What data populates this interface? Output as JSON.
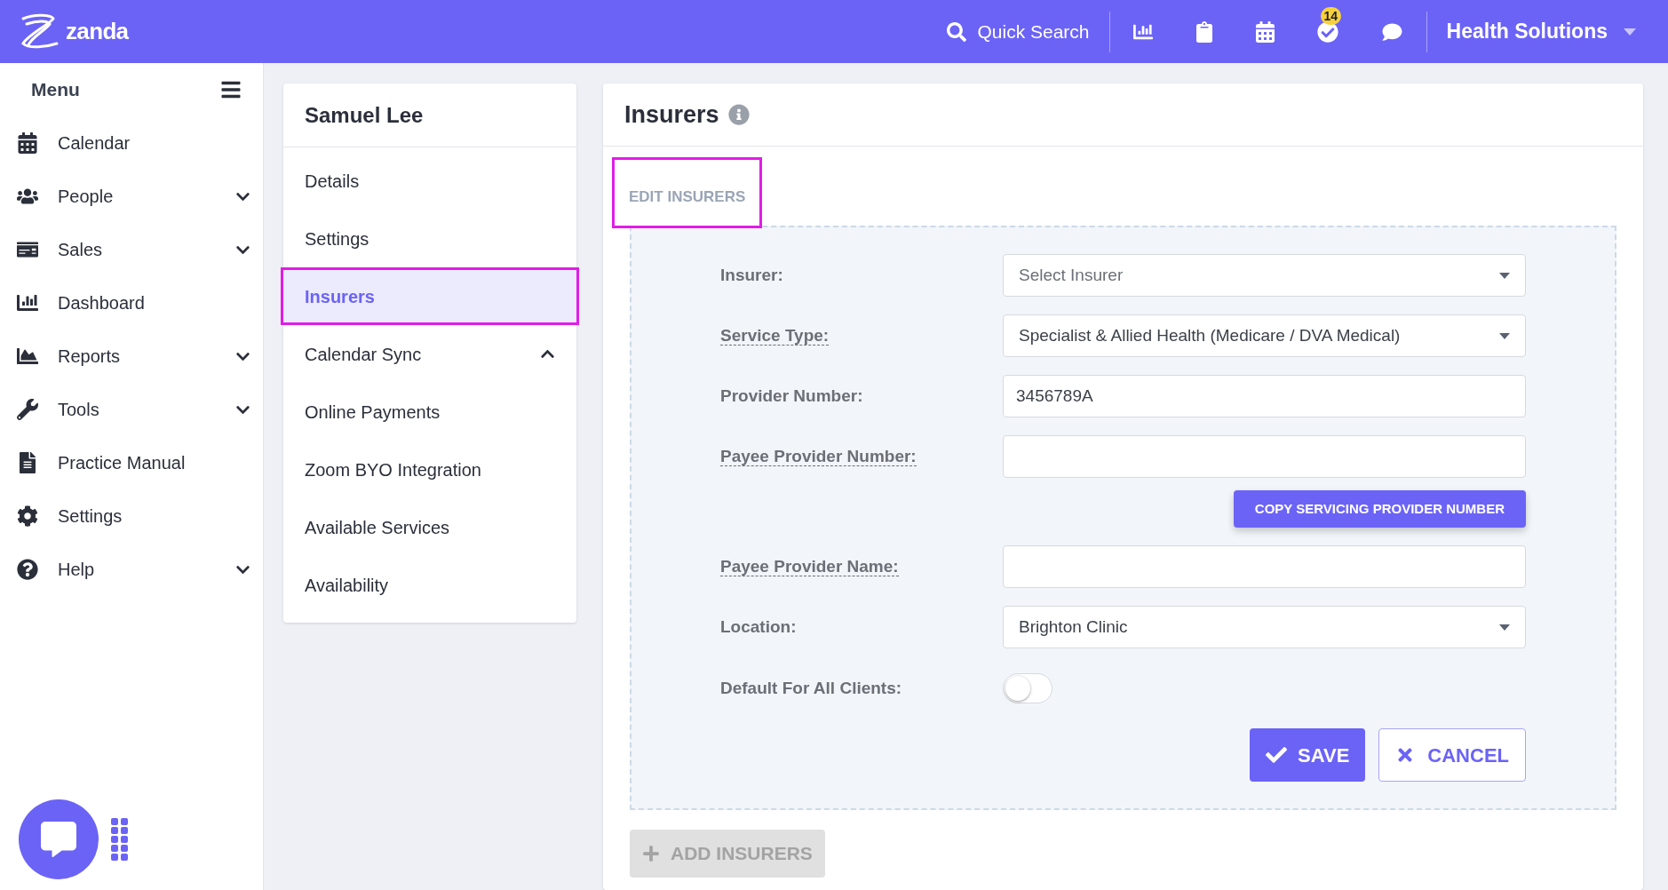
{
  "topbar": {
    "logo": "zanda",
    "search_label": "Quick Search",
    "tasks_badge": "14",
    "account": "Health Solutions"
  },
  "sidebar": {
    "title": "Menu",
    "items": [
      {
        "label": "Calendar",
        "expandable": false
      },
      {
        "label": "People",
        "expandable": true
      },
      {
        "label": "Sales",
        "expandable": true
      },
      {
        "label": "Dashboard",
        "expandable": false
      },
      {
        "label": "Reports",
        "expandable": true
      },
      {
        "label": "Tools",
        "expandable": true
      },
      {
        "label": "Practice Manual",
        "expandable": false
      },
      {
        "label": "Settings",
        "expandable": false
      },
      {
        "label": "Help",
        "expandable": true
      }
    ]
  },
  "profile_nav": {
    "name": "Samuel Lee",
    "items": [
      {
        "label": "Details",
        "kind": "link",
        "selected": false,
        "highlighted": false
      },
      {
        "label": "Settings",
        "kind": "link",
        "selected": false,
        "highlighted": false
      },
      {
        "label": "Insurers",
        "kind": "link",
        "selected": true,
        "highlighted": true
      },
      {
        "label": "Calendar Sync",
        "kind": "group",
        "expanded": true,
        "selected": false,
        "highlighted": false
      },
      {
        "label": "Online Payments",
        "kind": "link",
        "selected": false,
        "highlighted": false
      },
      {
        "label": "Zoom BYO Integration",
        "kind": "link",
        "selected": false,
        "highlighted": false
      },
      {
        "label": "Available Services",
        "kind": "link",
        "selected": false,
        "highlighted": false
      },
      {
        "label": "Availability",
        "kind": "link",
        "selected": false,
        "highlighted": false
      }
    ]
  },
  "insurers": {
    "title": "Insurers",
    "section_label": "EDIT INSURERS",
    "section_highlighted": true,
    "fields": [
      {
        "label": "Insurer:",
        "kind": "select",
        "hint": false,
        "placeholder": "Select Insurer"
      },
      {
        "label": "Service Type:",
        "kind": "select",
        "hint": true,
        "value": "Specialist & Allied Health (Medicare / DVA Medical)"
      },
      {
        "label": "Provider Number:",
        "kind": "input",
        "hint": false,
        "value": "3456789A"
      },
      {
        "label": "Payee Provider Number:",
        "kind": "input",
        "hint": true,
        "action": "COPY SERVICING PROVIDER NUMBER"
      },
      {
        "label": "Payee Provider Name:",
        "kind": "input",
        "hint": true
      },
      {
        "label": "Location:",
        "kind": "select",
        "hint": false,
        "value": "Brighton Clinic"
      },
      {
        "label": "Default For All Clients:",
        "kind": "toggle",
        "hint": false,
        "on": false
      }
    ],
    "save": "SAVE",
    "cancel": "CANCEL",
    "add": "ADD INSURERS",
    "add_disabled": true
  }
}
